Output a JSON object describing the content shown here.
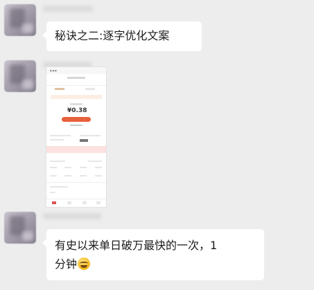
{
  "messages": [
    {
      "text": "秘诀之二:逐字优化文案"
    },
    {
      "image": "screenshot",
      "screenshot": {
        "big_value": "¥0.38"
      }
    },
    {
      "text": "有史以来单日破万最快的一次，1\n分钟",
      "emoji": "laughing-tears-emoji"
    }
  ]
}
